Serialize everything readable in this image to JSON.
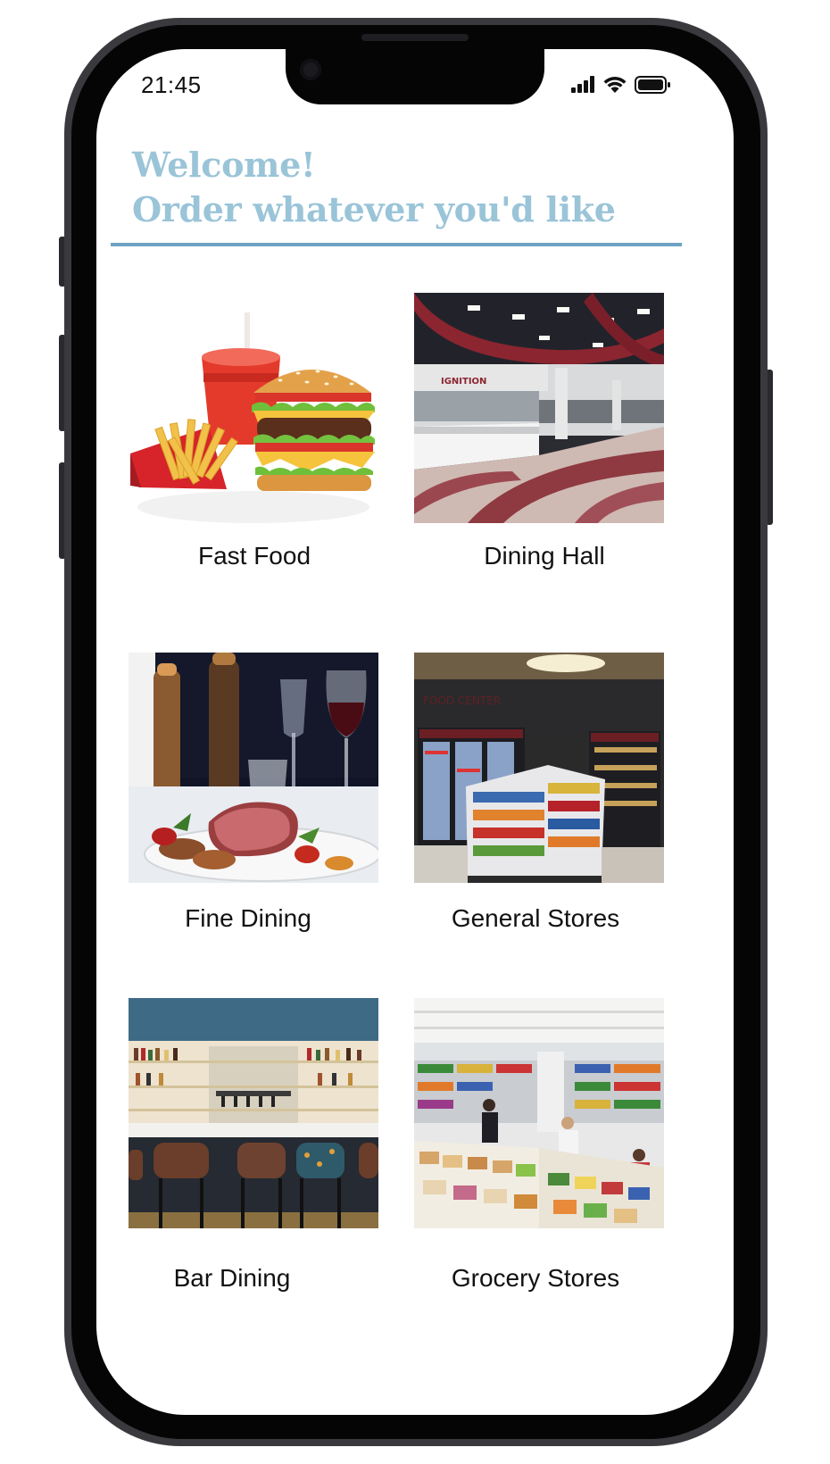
{
  "status_bar": {
    "time": "21:45",
    "signal_icon": "cellular-signal-icon",
    "wifi_icon": "wifi-icon",
    "battery_icon": "battery-icon"
  },
  "header": {
    "line1": "Welcome!",
    "line2": "Order whatever you'd like",
    "color": "#9ac4d8",
    "rule_color": "#6fa3c4"
  },
  "categories": [
    {
      "label": "Fast Food"
    },
    {
      "label": "Dining Hall"
    },
    {
      "label": "Fine Dining"
    },
    {
      "label": "General Stores"
    },
    {
      "label": "Bar Dining"
    },
    {
      "label": "Grocery Stores"
    }
  ]
}
